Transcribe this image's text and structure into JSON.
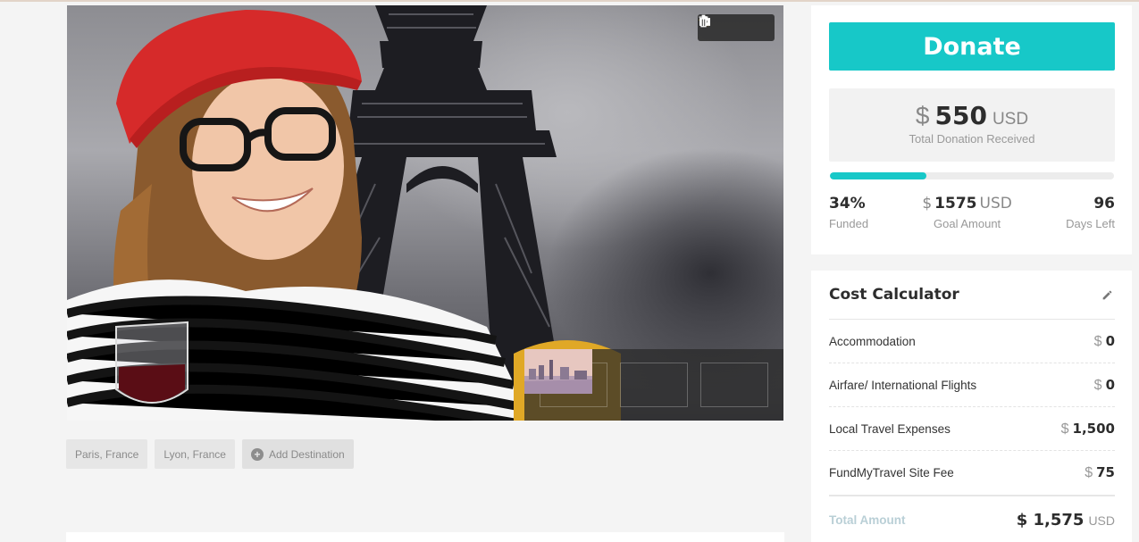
{
  "hero": {
    "tools": [
      {
        "icon": "star-icon",
        "color": "#f5c518"
      },
      {
        "icon": "camera-icon"
      },
      {
        "icon": "trash-icon"
      }
    ],
    "thumbnails": [
      "thumbnail-paris-selfie",
      "thumbnail-lyon-river",
      "thumbnail-city-skyline"
    ]
  },
  "destinations": {
    "items": [
      "Paris, France",
      "Lyon, France"
    ],
    "add_label": "Add Destination"
  },
  "donation": {
    "button_label": "Donate",
    "currency_symbol": "$",
    "total_amount": "550",
    "currency_code": "USD",
    "total_label": "Total Donation Received",
    "progress_fraction": 0.34,
    "funded_value": "34%",
    "funded_label": "Funded",
    "goal_symbol": "$",
    "goal_value": "1575",
    "goal_code": "USD",
    "goal_label": "Goal Amount",
    "days_value": "96",
    "days_label": "Days Left",
    "accent_color": "#17c8c8"
  },
  "calculator": {
    "title": "Cost Calculator",
    "edit_icon": "pencil-icon",
    "rows": [
      {
        "name": "Accommodation",
        "symbol": "$",
        "amount": "0"
      },
      {
        "name": "Airfare/ International Flights",
        "symbol": "$",
        "amount": "0"
      },
      {
        "name": "Local Travel Expenses",
        "symbol": "$",
        "amount": "1,500"
      },
      {
        "name": "FundMyTravel Site Fee",
        "symbol": "$",
        "amount": "75"
      }
    ],
    "total_label": "Total Amount",
    "total_amount": "$ 1,575",
    "total_code": "USD"
  }
}
